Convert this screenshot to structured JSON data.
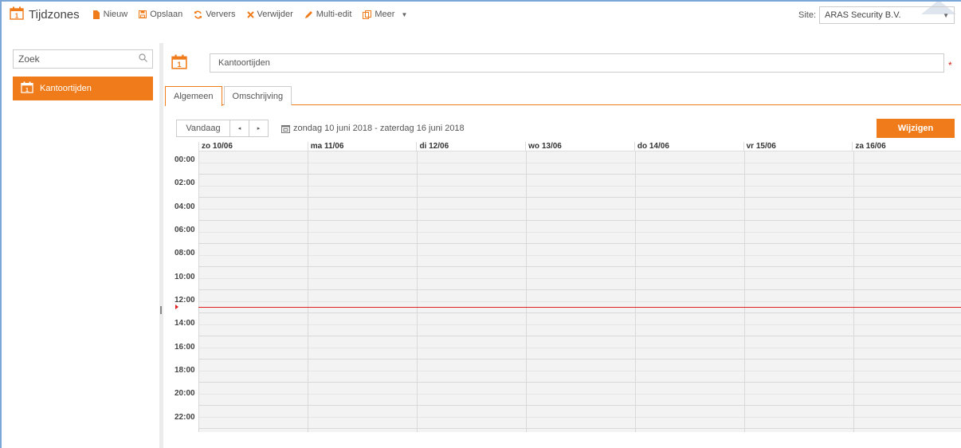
{
  "app": {
    "title": "Tijdzones"
  },
  "toolbar": {
    "new": "Nieuw",
    "save": "Opslaan",
    "refresh": "Ververs",
    "delete": "Verwijder",
    "multi_edit": "Multi-edit",
    "more": "Meer"
  },
  "site": {
    "label": "Site:",
    "value": "ARAS Security B.V."
  },
  "sidebar": {
    "search_placeholder": "Zoek",
    "items": [
      {
        "label": "Kantoortijden",
        "selected": true
      }
    ]
  },
  "record": {
    "name": "Kantoortijden",
    "required_marker": "*"
  },
  "tabs": [
    {
      "label": "Algemeen",
      "active": true
    },
    {
      "label": "Omschrijving",
      "active": false
    }
  ],
  "calendar": {
    "today_label": "Vandaag",
    "prev_label": "◂",
    "next_label": "▸",
    "range_label": "zondag 10 juni 2018 - zaterdag 16 juni 2018",
    "edit_label": "Wijzigen",
    "days": [
      "zo 10/06",
      "ma 11/06",
      "di 12/06",
      "wo 13/06",
      "do 14/06",
      "vr 15/06",
      "za 16/06"
    ],
    "hours": [
      "00:00",
      "02:00",
      "04:00",
      "06:00",
      "08:00",
      "10:00",
      "12:00",
      "14:00",
      "16:00",
      "18:00",
      "20:00",
      "22:00"
    ],
    "now_hour": 13.3
  },
  "colors": {
    "accent": "#f07b1a",
    "now_line": "#e02020",
    "frame": "#7aa6d8"
  },
  "icons": {
    "app": "calendar-icon",
    "new": "file-icon",
    "save": "floppy-icon",
    "refresh": "refresh-icon",
    "delete": "x-icon",
    "multi_edit": "pencil-icon",
    "more": "copy-icon",
    "search": "search-icon"
  }
}
